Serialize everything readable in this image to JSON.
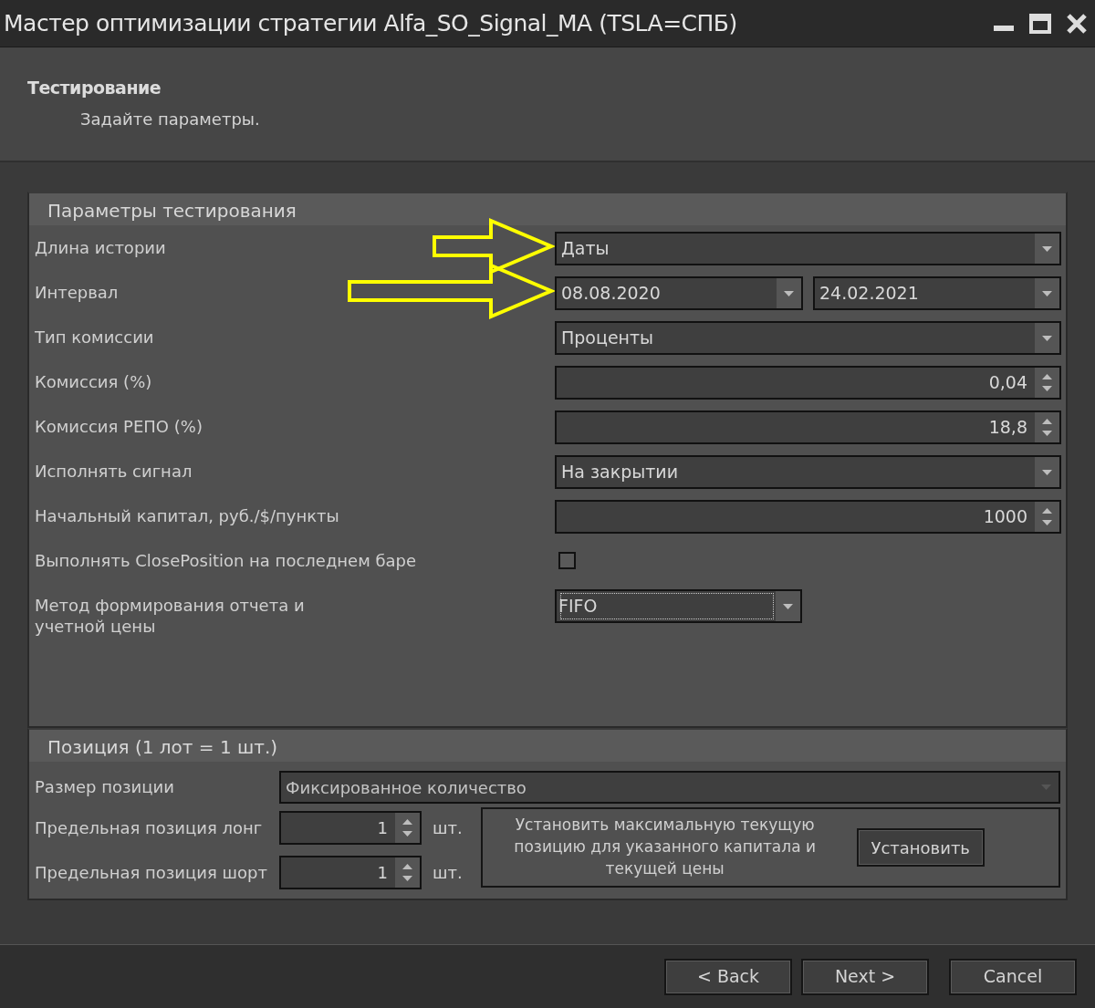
{
  "window": {
    "title": "Мастер оптимизации стратегии Alfa_SO_Signal_MA (TSLA=СПБ)"
  },
  "header": {
    "title": "Тестирование",
    "subtitle": "Задайте параметры."
  },
  "test_params": {
    "title": "Параметры тестирования",
    "rows": [
      {
        "kind": "dropdown",
        "label": "Длина истории",
        "value": "Даты",
        "annotated": true
      },
      {
        "kind": "date_range",
        "label": "Интервал",
        "from": "08.08.2020",
        "to": "24.02.2021",
        "annotated": true
      },
      {
        "kind": "dropdown",
        "label": "Тип комиссии",
        "value": "Проценты"
      },
      {
        "kind": "spin",
        "label": "Комиссия (%)",
        "value": "0,04"
      },
      {
        "kind": "spin",
        "label": "Комиссия РЕПО (%)",
        "value": "18,8"
      },
      {
        "kind": "dropdown",
        "label": "Исполнять сигнал",
        "value": "На закрытии"
      },
      {
        "kind": "spin",
        "label": "Начальный капитал, руб./$/пункты",
        "value": "1000"
      },
      {
        "kind": "checkbox",
        "label": "Выполнять ClosePosition на последнем баре",
        "checked": false
      },
      {
        "kind": "short_dropdown",
        "label": "Метод формирования отчета и учетной цены",
        "value": "FIFO",
        "focused": true
      }
    ]
  },
  "position": {
    "title": "Позиция (1 лот = 1 шт.)",
    "size_label": "Размер позиции",
    "size_value": "Фиксированное количество",
    "size_disabled": true,
    "limits": [
      {
        "label": "Предельная позиция лонг",
        "value": "1",
        "unit": "шт."
      },
      {
        "label": "Предельная позиция шорт",
        "value": "1",
        "unit": "шт."
      }
    ],
    "hint": "Установить максимальную текущую позицию для указанного капитала и текущей цены",
    "set_button": "Установить"
  },
  "buttons": [
    {
      "label": "< Back",
      "kind": "nav"
    },
    {
      "label": "Next >",
      "kind": "nav"
    },
    {
      "label": "Cancel",
      "kind": "cancel"
    }
  ]
}
